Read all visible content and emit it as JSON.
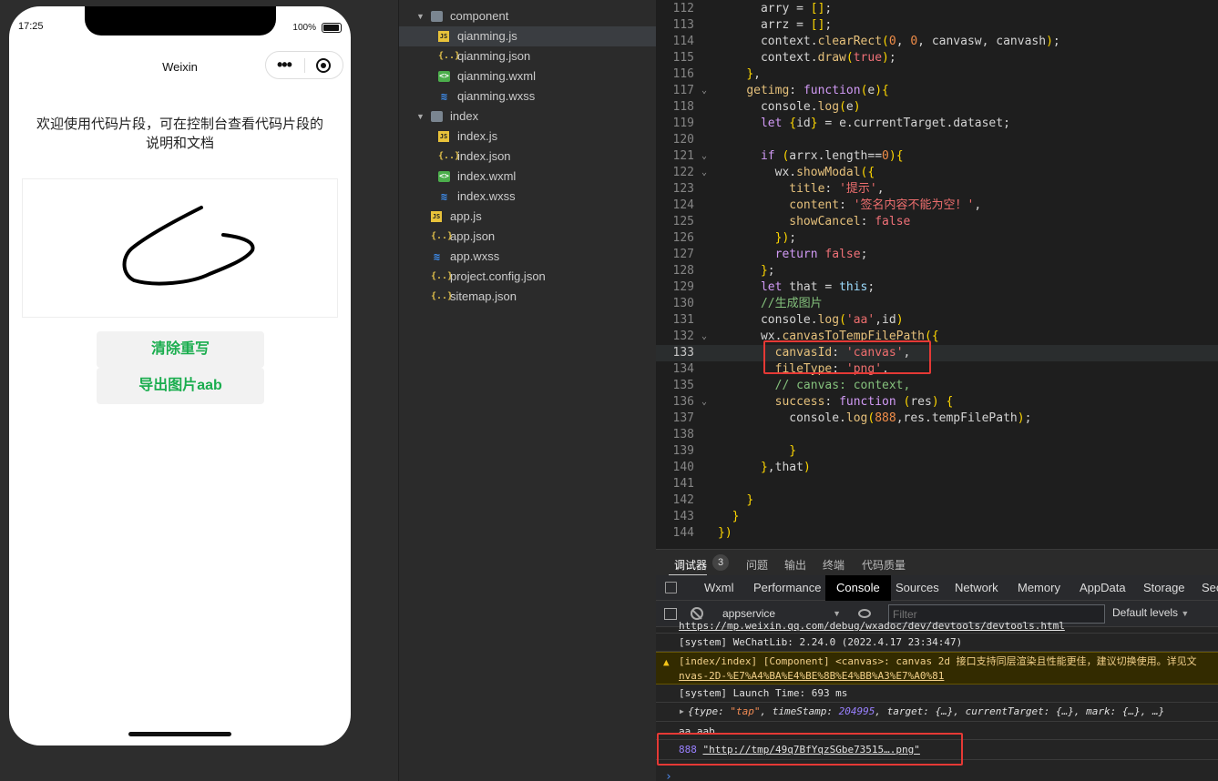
{
  "simulator": {
    "time": "17:25",
    "battery": "100%",
    "nav_title": "Weixin",
    "welcome": "欢迎使用代码片段，可在控制台查看代码片段的说明和文档",
    "button_clear": "清除重写",
    "button_export": "导出图片aab"
  },
  "tree": {
    "items": [
      {
        "type": "folder",
        "label": "component"
      },
      {
        "type": "js",
        "label": "qianming.js"
      },
      {
        "type": "json",
        "label": "qianming.json"
      },
      {
        "type": "wxml",
        "label": "qianming.wxml"
      },
      {
        "type": "wxss",
        "label": "qianming.wxss"
      },
      {
        "type": "folder",
        "label": "index"
      },
      {
        "type": "js",
        "label": "index.js"
      },
      {
        "type": "json",
        "label": "index.json"
      },
      {
        "type": "wxml",
        "label": "index.wxml"
      },
      {
        "type": "wxss",
        "label": "index.wxss"
      },
      {
        "type": "js",
        "label": "app.js"
      },
      {
        "type": "json",
        "label": "app.json"
      },
      {
        "type": "wxss",
        "label": "app.wxss"
      },
      {
        "type": "json",
        "label": "project.config.json"
      },
      {
        "type": "json",
        "label": "sitemap.json"
      }
    ]
  },
  "editor": {
    "current_line": 133,
    "lines": [
      {
        "n": "112",
        "code": "      arry = [];"
      },
      {
        "n": "113",
        "code": "      arrz = [];"
      },
      {
        "n": "114",
        "code": "      context.clearRect(0, 0, canvasw, canvash);"
      },
      {
        "n": "115",
        "code": "      context.draw(true);"
      },
      {
        "n": "116",
        "code": "    },"
      },
      {
        "n": "117",
        "code": "    getimg: function(e){"
      },
      {
        "n": "118",
        "code": "      console.log(e)"
      },
      {
        "n": "119",
        "code": "      let {id} = e.currentTarget.dataset;"
      },
      {
        "n": "120",
        "code": ""
      },
      {
        "n": "121",
        "code": "      if (arrx.length==0){"
      },
      {
        "n": "122",
        "code": "        wx.showModal({"
      },
      {
        "n": "123",
        "code": "          title: '提示',"
      },
      {
        "n": "124",
        "code": "          content: '签名内容不能为空！',"
      },
      {
        "n": "125",
        "code": "          showCancel: false"
      },
      {
        "n": "126",
        "code": "        });"
      },
      {
        "n": "127",
        "code": "        return false;"
      },
      {
        "n": "128",
        "code": "      };"
      },
      {
        "n": "129",
        "code": "      let that = this;"
      },
      {
        "n": "130",
        "code": "      //生成图片"
      },
      {
        "n": "131",
        "code": "      console.log('aa',id)"
      },
      {
        "n": "132",
        "code": "      wx.canvasToTempFilePath({"
      },
      {
        "n": "133",
        "code": "        canvasId: 'canvas',"
      },
      {
        "n": "134",
        "code": "        fileType: 'png',"
      },
      {
        "n": "135",
        "code": "        // canvas: context,"
      },
      {
        "n": "136",
        "code": "        success: function (res) {"
      },
      {
        "n": "137",
        "code": "          console.log(888,res.tempFilePath);"
      },
      {
        "n": "138",
        "code": ""
      },
      {
        "n": "139",
        "code": "          }"
      },
      {
        "n": "140",
        "code": "      },that)"
      },
      {
        "n": "141",
        "code": ""
      },
      {
        "n": "142",
        "code": "    }"
      },
      {
        "n": "143",
        "code": "  }"
      },
      {
        "n": "144",
        "code": "})"
      }
    ]
  },
  "debug": {
    "tabs": [
      {
        "label": "调试器"
      },
      {
        "label": "问题"
      },
      {
        "label": "输出"
      },
      {
        "label": "终端"
      },
      {
        "label": "代码质量"
      }
    ],
    "badge": "3",
    "devtools_tabs": [
      "Wxml",
      "Performance",
      "Console",
      "Sources",
      "Network",
      "Memory",
      "AppData",
      "Storage",
      "Sec"
    ],
    "context": "appservice",
    "filter_placeholder": "Filter",
    "levels": "Default levels",
    "log": {
      "link_cut": "https://mp.weixin.qq.com/debug/wxadoc/dev/devtools/devtools.html",
      "wechatlib": "[system] WeChatLib: 2.24.0 (2022.4.17 23:34:47)",
      "warn_line1": "[index/index] [Component] <canvas>: canvas 2d 接口支持同层渲染且性能更佳，建议切换使用。详见文",
      "warn_line2": "nvas-2D-%E7%A4%BA%E4%BE%8B%E4%BB%A3%E7%A0%81",
      "launch": "[system] Launch Time: 693 ms",
      "obj_open": "{type: ",
      "obj_type": "\"tap\"",
      "obj_mid": ", timeStamp: ",
      "obj_ts": "204995",
      "obj_rest": ", target: {…}, currentTarget: {…}, mark: {…}, …}",
      "aa": "aa aab",
      "n888": "888",
      "path": "\"http://tmp/49q7BfYqzSGbe73515….png\""
    }
  }
}
